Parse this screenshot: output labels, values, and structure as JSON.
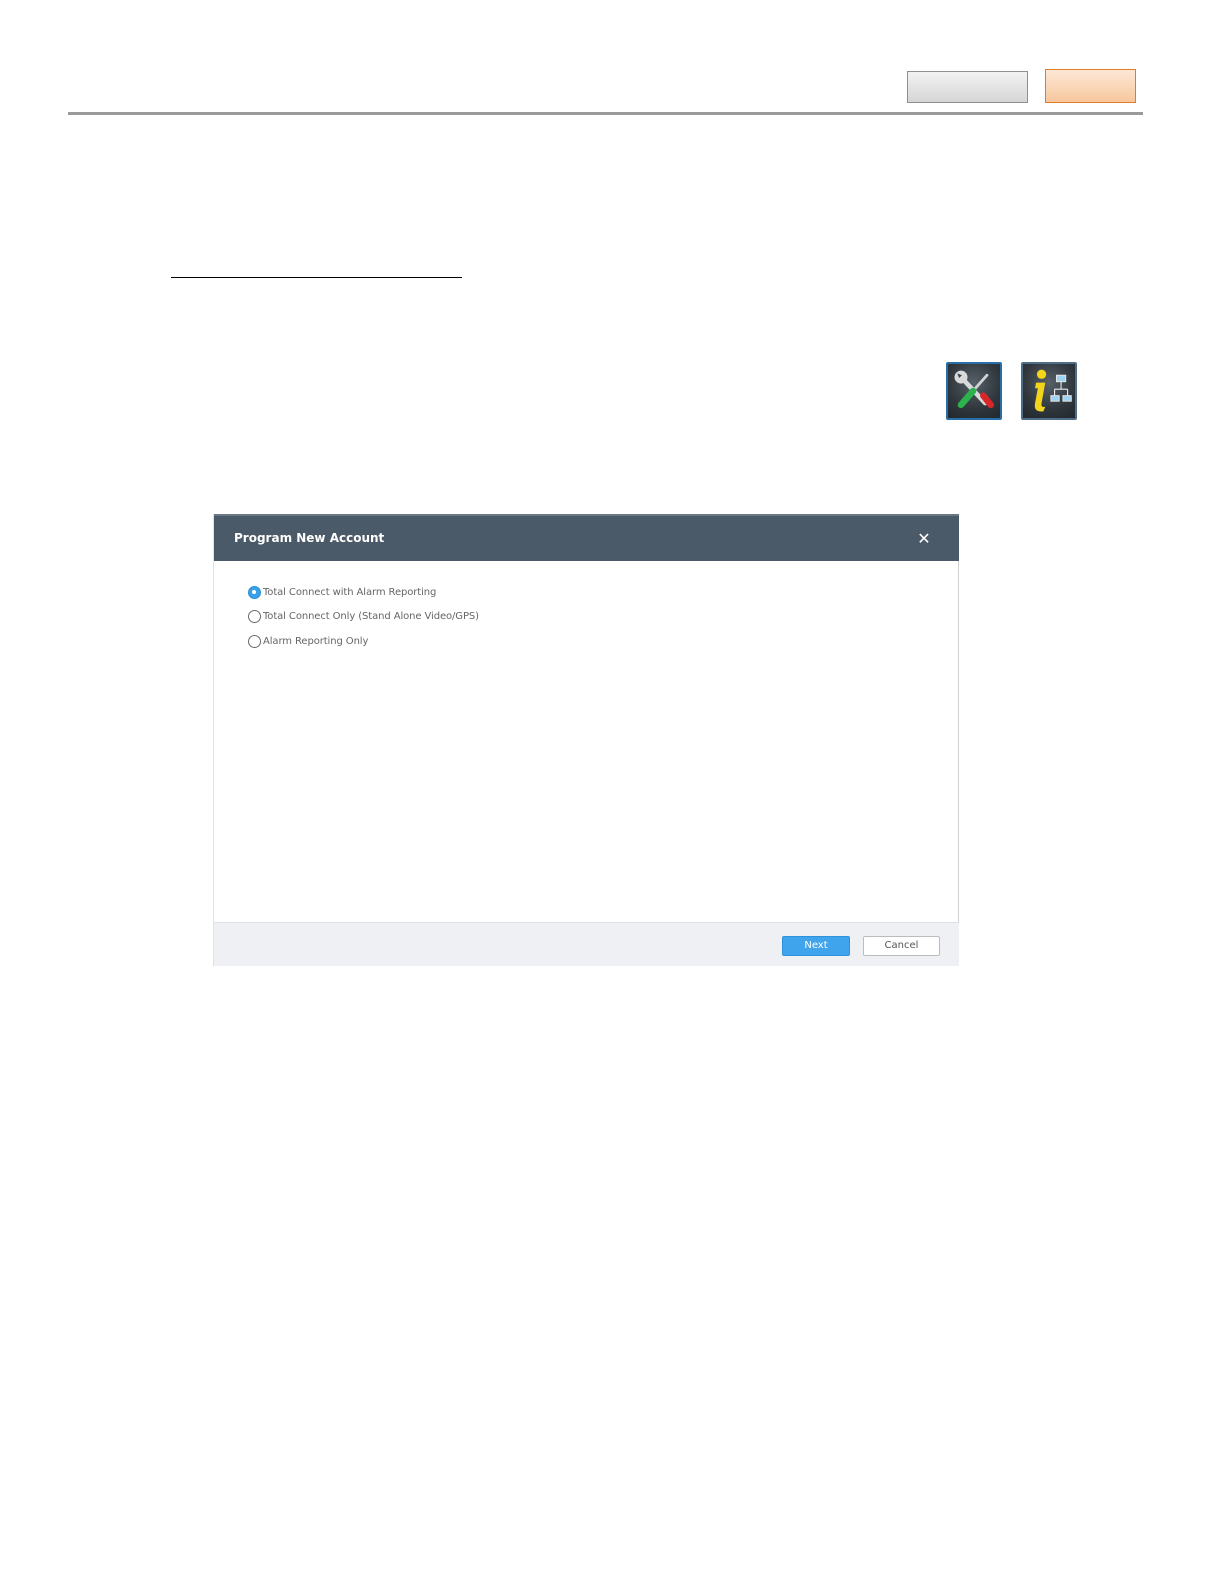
{
  "dialog": {
    "title": "Program New Account",
    "close_glyph": "✕",
    "options": [
      {
        "label": "Total Connect with Alarm Reporting",
        "selected": true
      },
      {
        "label": "Total Connect Only (Stand Alone Video/GPS)",
        "selected": false
      },
      {
        "label": "Alarm Reporting Only",
        "selected": false
      }
    ],
    "next_label": "Next",
    "cancel_label": "Cancel"
  },
  "icons": {
    "tools": "tools-icon",
    "info": "info-network-icon"
  },
  "colors": {
    "dialog_header": "#4b5a69",
    "next_button": "#3fa4ec",
    "selected_radio": "#3aa0e8",
    "orange_tab": "#f7c79d",
    "gray_tab": "#d6d6d6"
  }
}
